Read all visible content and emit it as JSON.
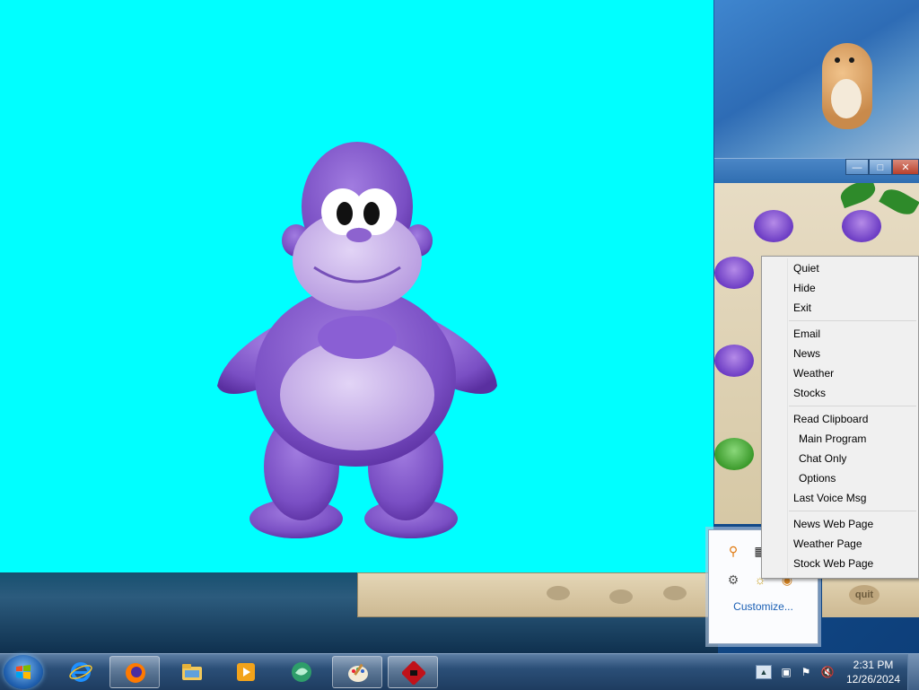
{
  "context_menu": {
    "items": [
      {
        "label": "Quiet",
        "indent": false
      },
      {
        "label": "Hide",
        "indent": false
      },
      {
        "label": "Exit",
        "indent": false
      },
      {
        "sep": true
      },
      {
        "label": "Email",
        "indent": false
      },
      {
        "label": "News",
        "indent": false
      },
      {
        "label": "Weather",
        "indent": false
      },
      {
        "label": "Stocks",
        "indent": false
      },
      {
        "sep": true
      },
      {
        "label": "Read Clipboard",
        "indent": false
      },
      {
        "label": "Main Program",
        "indent": true
      },
      {
        "label": "Chat Only",
        "indent": true
      },
      {
        "label": "Options",
        "indent": true
      },
      {
        "label": "Last Voice Msg",
        "indent": false
      },
      {
        "sep": true
      },
      {
        "label": "News Web Page",
        "indent": false
      },
      {
        "label": "Weather Page",
        "indent": false
      },
      {
        "label": "Stock Web Page",
        "indent": false
      }
    ]
  },
  "tray_popup": {
    "customize_label": "Customize..."
  },
  "game_window": {
    "quit_label": "quit"
  },
  "taskbar": {
    "apps": [
      {
        "name": "internet-explorer",
        "active": false
      },
      {
        "name": "firefox",
        "active": true
      },
      {
        "name": "file-explorer",
        "active": false
      },
      {
        "name": "media-player",
        "active": false
      },
      {
        "name": "messenger",
        "active": false
      },
      {
        "name": "paint",
        "active": true
      },
      {
        "name": "game-app",
        "active": true
      }
    ],
    "clock_time": "2:31 PM",
    "clock_date": "12/26/2024"
  },
  "colors": {
    "bonzi_background": "#00ffff",
    "gorilla_purple": "#7a4fc4",
    "taskbar": "#2b4f78"
  }
}
